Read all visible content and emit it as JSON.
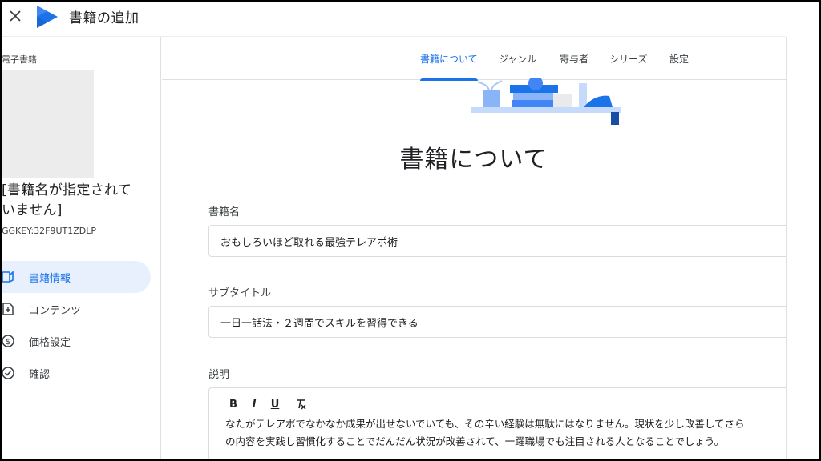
{
  "header": {
    "title": "書籍の追加",
    "close_icon": "close-icon",
    "logo_icon": "play-books-logo"
  },
  "sidebar": {
    "section_label": "電子書籍",
    "book_title_line1": "[書籍名が指定されて",
    "book_title_line2": "いません]",
    "book_key": "GGKEY:32F9UT1ZDLP",
    "nav": [
      {
        "label": "書籍情報",
        "icon": "book-info-icon",
        "active": true
      },
      {
        "label": "コンテンツ",
        "icon": "add-file-icon",
        "active": false
      },
      {
        "label": "価格設定",
        "icon": "dollar-icon",
        "active": false
      },
      {
        "label": "確認",
        "icon": "check-circle-icon",
        "active": false
      }
    ]
  },
  "tabs": [
    {
      "label": "書籍について",
      "active": true
    },
    {
      "label": "ジャンル",
      "active": false
    },
    {
      "label": "寄与者",
      "active": false
    },
    {
      "label": "シリーズ",
      "active": false
    },
    {
      "label": "設定",
      "active": false
    }
  ],
  "main": {
    "heading": "書籍について",
    "fields": {
      "title": {
        "label": "書籍名",
        "value": "おもしろいほど取れる最強テレアポ術"
      },
      "subtitle": {
        "label": "サブタイトル",
        "value": "一日一話法・２週間でスキルを習得できる"
      },
      "description": {
        "label": "説明",
        "line1": "なたがテレアポでなかなか成果が出せないでいても、その辛い経験は無駄にはなりません。現状を少し改善してさら",
        "line2": "の内容を実践し習慣化することでだんだん状況が改善されて、一躍職場でも注目される人となることでしょう。"
      }
    },
    "toolbar": {
      "bold": "B",
      "italic": "I",
      "underline": "U",
      "clear_format_icon": "clear-format-icon"
    }
  },
  "colors": {
    "accent": "#1a73e8",
    "active_bg": "#e8f0fe",
    "border": "#dadce0"
  }
}
